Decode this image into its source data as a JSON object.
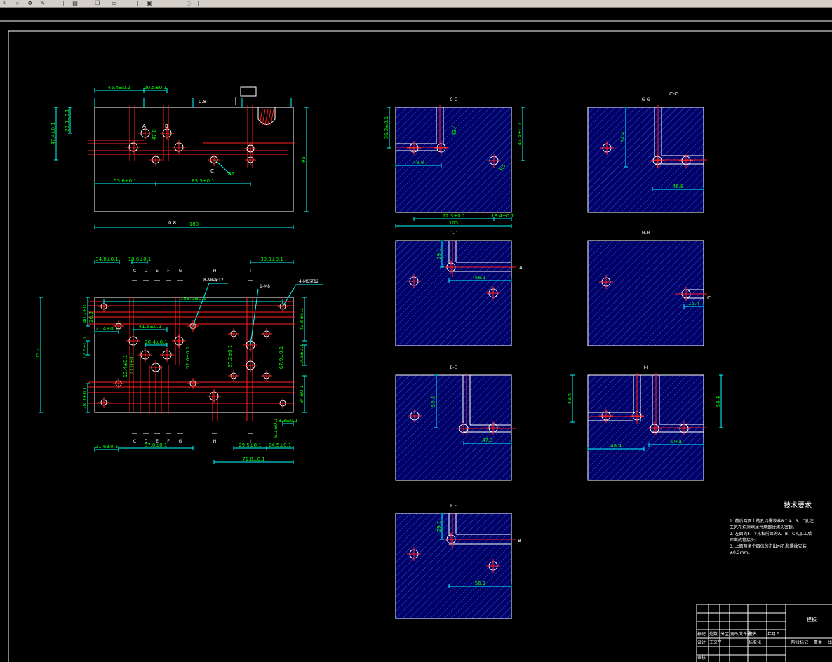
{
  "toolbar": {
    "buttons": [
      {
        "name": "arrow-icon",
        "glyph": "↖"
      },
      {
        "name": "zoom-icon",
        "glyph": "⌕"
      },
      {
        "name": "pan-icon",
        "glyph": "✥"
      },
      {
        "name": "highlight-icon",
        "glyph": "✎"
      },
      {
        "name": "layer-icon",
        "glyph": "▤"
      },
      {
        "name": "copy-icon",
        "glyph": "❐"
      },
      {
        "name": "print-icon",
        "glyph": "▭"
      },
      {
        "name": "save-icon",
        "glyph": "▣"
      },
      {
        "name": "disabled-icon",
        "glyph": "◌"
      }
    ]
  },
  "colors": {
    "background": "#000000",
    "dimension": "#00ff00",
    "extension": "#00ffff",
    "centerline": "#ff2020",
    "geometry": "#ffffff",
    "hatch_fill": "#000066",
    "hatch_line": "#2a5bd7",
    "note": "#ffffff"
  },
  "front_view": {
    "dims": [
      "45.4±0.1",
      "20.5±0.1",
      "23.3±0.1",
      "47.4±0.1",
      "47.8",
      "55.6±0.1",
      "85.3±0.1",
      "180",
      "95",
      "0.8",
      "0.8",
      "R2"
    ],
    "labels": [
      "A",
      "B",
      "C"
    ]
  },
  "top_view": {
    "dims": [
      "34.8±0.1",
      "10.6±0.1",
      "39.3±0.1",
      "163.0±0.1",
      "40.2±0.1",
      "21.4±0.1",
      "41.6±0.1",
      "20.4±0.1",
      "12.5±0.1",
      "12.4±0.1",
      "13.0±0.1",
      "52.6±0.1",
      "37.2±0.1",
      "67.9±0.1",
      "42.6±0.1",
      "10.5±0.1",
      "34±0.1",
      "28.3±0.1",
      "105.2",
      "21.6±0.1",
      "87.0±0.1",
      "29.5±0.1",
      "24.5±0.1",
      "71.8±0.1",
      "9.1±0.1",
      "8.3±0.1",
      "26.3"
    ],
    "leader_notes": [
      "8-M6深12",
      "1-M8",
      "4-M6深12"
    ],
    "section_marks_top": [
      "C",
      "D",
      "E",
      "F",
      "G",
      "H",
      "I"
    ],
    "section_marks_bottom": [
      "C",
      "D",
      "E",
      "F",
      "G",
      "H",
      "I"
    ]
  },
  "sections": [
    {
      "title": "C-C",
      "dims": [
        "36.2±0.1",
        "43.4",
        "47.4±0.1",
        "48.8",
        "72.3±0.1",
        "18.4±0.1",
        "105",
        "R5"
      ],
      "marks": []
    },
    {
      "title": "G-G",
      "title2": "C-C",
      "dims": [
        "54.4",
        "46.8"
      ],
      "marks": []
    },
    {
      "title": "D-D",
      "dims": [
        "29.1",
        "56.1"
      ],
      "marks": [
        "A"
      ]
    },
    {
      "title": "H-H",
      "dims": [
        "15.4"
      ],
      "marks": [
        "C"
      ]
    },
    {
      "title": "E-E",
      "dims": [
        "54.4",
        "47.3"
      ],
      "marks": []
    },
    {
      "title": "I-I",
      "dims": [
        "43.4",
        "54.4",
        "48.4",
        "49.4"
      ],
      "marks": []
    },
    {
      "title": "F-F",
      "dims": [
        "29.1",
        "56.1"
      ],
      "marks": [
        "B"
      ]
    }
  ],
  "notes": {
    "heading": "技术要求",
    "lines": [
      "1. 前后两面上的孔均需攻丝8个A、B、C孔注",
      "工艺孔均须堵丝并用螺纹堵头密封。",
      "2. 左面的F、Y孔和前面的A、B、C孔加工后",
      "距离的管接头。",
      "3. 上面两条个四位的进出水孔和螺纹安装",
      "±0.2mm。"
    ]
  },
  "title_block": {
    "part_name": "模板",
    "row_labels": [
      "标记",
      "处数",
      "分区",
      "更改文件号",
      "签名",
      "年月日"
    ],
    "designer_row": [
      "设计",
      "王文平",
      "标准化"
    ],
    "stage_labels": [
      "阶段标记",
      "重量",
      "比例"
    ],
    "bottom": [
      "审核"
    ]
  }
}
